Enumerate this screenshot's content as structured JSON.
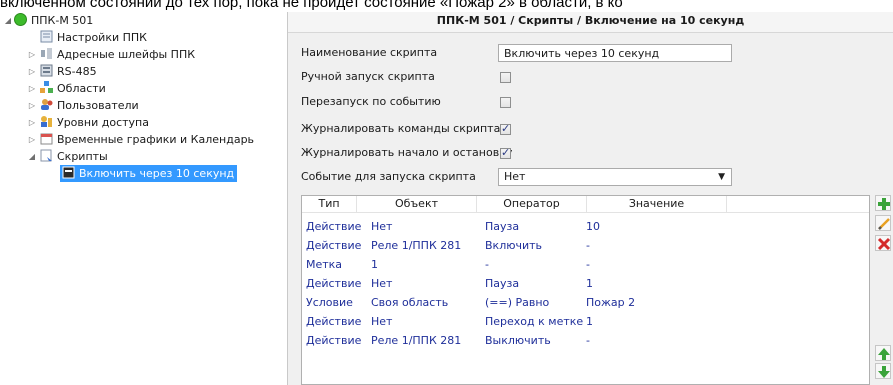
{
  "caption": "включенном состоянии до тех пор, пока не пройдет состояние «Пожар 2» в области, в ко",
  "tree": {
    "root": "ППК-М 501",
    "items": [
      {
        "label": "Настройки ППК",
        "icon": "settings-page-icon"
      },
      {
        "label": "Адресные шлейфы ППК",
        "icon": "loop-icon"
      },
      {
        "label": "RS-485",
        "icon": "rs485-icon"
      },
      {
        "label": "Области",
        "icon": "areas-icon"
      },
      {
        "label": "Пользователи",
        "icon": "users-icon"
      },
      {
        "label": "Уровни доступа",
        "icon": "access-levels-icon"
      },
      {
        "label": "Временные графики и Календарь",
        "icon": "calendar-icon"
      },
      {
        "label": "Скрипты",
        "icon": "scripts-icon"
      }
    ],
    "selected": "Включить через 10 секунд"
  },
  "header": "ППК-М 501 / Скрипты / Включение на 10 секунд",
  "form": {
    "name_label": "Наименование скрипта",
    "name_value": "Включить через 10 секунд",
    "manual_label": "Ручной запуск скрипта",
    "manual_checked": false,
    "restart_label": "Перезапуск по событию",
    "restart_checked": false,
    "log_commands_label": "Журналировать команды скрипта",
    "log_commands_checked": true,
    "log_startstop_label": "Журналировать начало и остановку",
    "log_startstop_checked": true,
    "event_label": "Событие для запуска скрипта",
    "event_value": "Нет"
  },
  "table": {
    "columns": [
      "Тип",
      "Объект",
      "Оператор",
      "Значение"
    ],
    "rows": [
      [
        "Действие",
        "Нет",
        "Пауза",
        "10"
      ],
      [
        "Действие",
        "Реле 1/ППК 281",
        "Включить",
        "-"
      ],
      [
        "Метка",
        "1",
        "-",
        "-"
      ],
      [
        "Действие",
        "Нет",
        "Пауза",
        "1"
      ],
      [
        "Условие",
        "Своя область",
        "(==) Равно",
        "Пожар 2"
      ],
      [
        "Действие",
        "Нет",
        "Переход к метке",
        "1"
      ],
      [
        "Действие",
        "Реле 1/ППК 281",
        "Выключить",
        "-"
      ]
    ]
  },
  "side_buttons": [
    "add-icon",
    "edit-icon",
    "delete-icon",
    "move-up-icon",
    "move-down-icon"
  ]
}
